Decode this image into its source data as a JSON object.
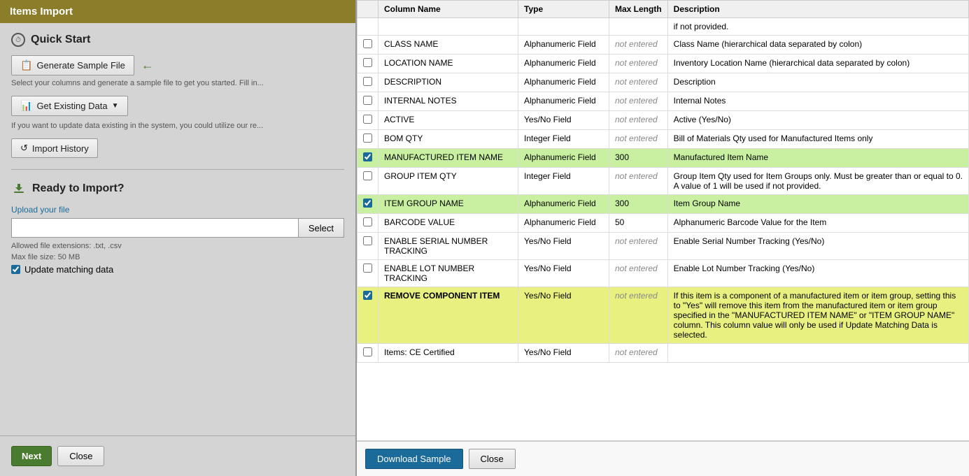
{
  "window": {
    "title": "Items Import"
  },
  "left": {
    "quick_start_title": "Quick Start",
    "generate_btn": "Generate Sample File",
    "generate_hint": "Select your columns and generate a sample file to get you started. Fill in...",
    "get_existing_btn": "Get Existing Data",
    "get_existing_hint": "If you want to update data existing in the system, you could utilize our re...",
    "import_history_btn": "Import History",
    "ready_title": "Ready to Import?",
    "upload_label": "Upload your file",
    "upload_placeholder": "",
    "select_btn": "Select",
    "file_extensions": "Allowed file extensions: .txt, .csv",
    "max_file_size": "Max file size: 50 MB",
    "update_matching_label": "Update matching data",
    "next_btn": "Next",
    "close_btn": "Close"
  },
  "table": {
    "columns": [
      "",
      "Column Name",
      "Type",
      "Max Length",
      "Description"
    ],
    "rows": [
      {
        "checked": false,
        "name": "",
        "type": "",
        "maxlen": "if not provided.",
        "desc": "",
        "highlight": "none",
        "name_col": ""
      },
      {
        "checked": false,
        "name": "CLASS NAME",
        "type": "Alphanumeric Field",
        "maxlen": "not entered",
        "desc": "Class Name (hierarchical data separated by colon)",
        "highlight": "none"
      },
      {
        "checked": false,
        "name": "LOCATION NAME",
        "type": "Alphanumeric Field",
        "maxlen": "not entered",
        "desc": "Inventory Location Name (hierarchical data separated by colon)",
        "highlight": "none"
      },
      {
        "checked": false,
        "name": "DESCRIPTION",
        "type": "Alphanumeric Field",
        "maxlen": "not entered",
        "desc": "Description",
        "highlight": "none"
      },
      {
        "checked": false,
        "name": "INTERNAL NOTES",
        "type": "Alphanumeric Field",
        "maxlen": "not entered",
        "desc": "Internal Notes",
        "highlight": "none"
      },
      {
        "checked": false,
        "name": "ACTIVE",
        "type": "Yes/No Field",
        "maxlen": "not entered",
        "desc": "Active (Yes/No)",
        "highlight": "none"
      },
      {
        "checked": false,
        "name": "BOM QTY",
        "type": "Integer Field",
        "maxlen": "not entered",
        "desc": "Bill of Materials Qty used for Manufactured Items only",
        "highlight": "none"
      },
      {
        "checked": true,
        "name": "MANUFACTURED ITEM NAME",
        "type": "Alphanumeric Field",
        "maxlen": "300",
        "desc": "Manufactured Item Name",
        "highlight": "green"
      },
      {
        "checked": false,
        "name": "GROUP ITEM QTY",
        "type": "Integer Field",
        "maxlen": "not entered",
        "desc": "Group Item Qty used for Item Groups only. Must be greater than or equal to 0. A value of 1 will be used if not provided.",
        "highlight": "none"
      },
      {
        "checked": true,
        "name": "ITEM GROUP NAME",
        "type": "Alphanumeric Field",
        "maxlen": "300",
        "desc": "Item Group Name",
        "highlight": "green"
      },
      {
        "checked": false,
        "name": "BARCODE VALUE",
        "type": "Alphanumeric Field",
        "maxlen": "50",
        "desc": "Alphanumeric Barcode Value for the Item",
        "highlight": "none"
      },
      {
        "checked": false,
        "name": "ENABLE SERIAL NUMBER TRACKING",
        "type": "Yes/No Field",
        "maxlen": "not entered",
        "desc": "Enable Serial Number Tracking (Yes/No)",
        "highlight": "none"
      },
      {
        "checked": false,
        "name": "ENABLE LOT NUMBER TRACKING",
        "type": "Yes/No Field",
        "maxlen": "not entered",
        "desc": "Enable Lot Number Tracking (Yes/No)",
        "highlight": "none"
      },
      {
        "checked": true,
        "name": "REMOVE COMPONENT ITEM",
        "type": "Yes/No Field",
        "maxlen": "not entered",
        "desc": "If this item is a component of a manufactured item or item group, setting this to \"Yes\" will remove this item from the manufactured item or item group specified in the \"MANUFACTURED ITEM NAME\" or \"ITEM GROUP NAME\" column. This column value will only be used if Update Matching Data is selected.",
        "highlight": "yellow"
      },
      {
        "checked": false,
        "name": "Items: CE Certified",
        "type": "Yes/No Field",
        "maxlen": "not entered",
        "desc": "",
        "highlight": "none"
      }
    ],
    "download_btn": "Download Sample",
    "close_btn": "Close"
  },
  "icons": {
    "clock": "⏱",
    "book": "📋",
    "chart": "📊",
    "history": "↺",
    "download": "⬇",
    "arrow": "←"
  }
}
